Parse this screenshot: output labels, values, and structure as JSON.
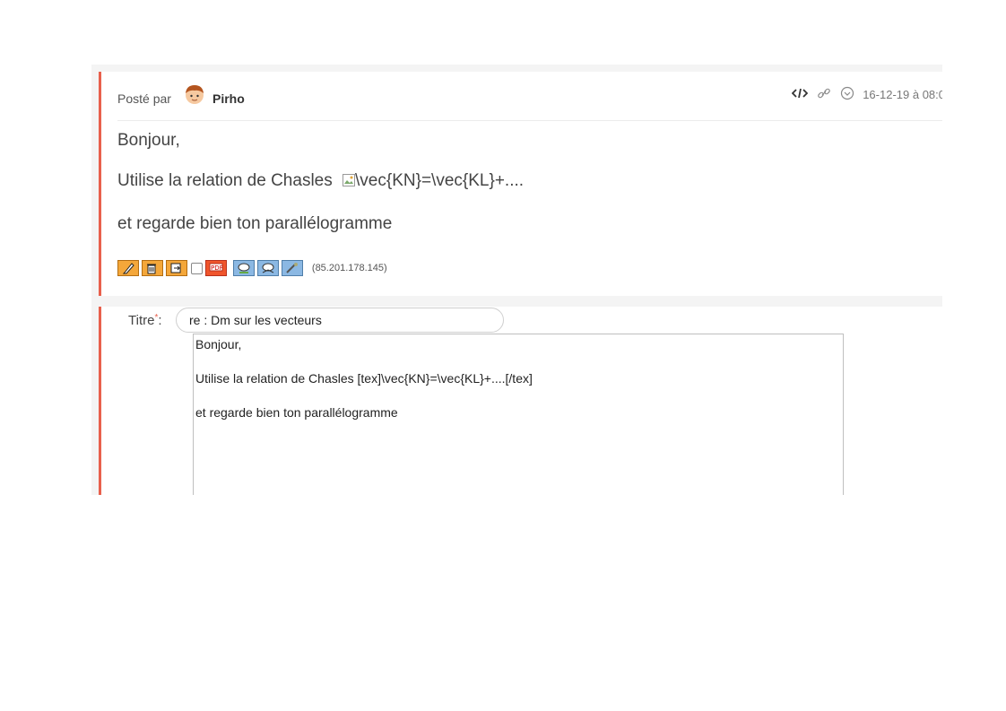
{
  "post": {
    "posted_by_label": "Posté par",
    "author": "Pirho",
    "date": "16-12-19 à 08:0",
    "body": {
      "greeting": "Bonjour,",
      "line1_prefix": "Utilise la relation de Chasles",
      "line1_img_alt": "\\vec{KN}=\\vec{KL}+....",
      "line2": "et regarde bien ton parallélogramme"
    },
    "ip": "(85.201.178.145)",
    "icons": {
      "code": "code-icon",
      "link": "link-icon",
      "clock": "clock-icon",
      "edit": "pencil-icon",
      "delete": "trash-icon",
      "move": "move-icon",
      "pdf": "pdf-icon",
      "tools": "tools-icon"
    }
  },
  "reply": {
    "title_label": "Titre",
    "required_mark": "*",
    "title_sep": ":",
    "title_value": "re : Dm sur les vecteurs",
    "editor": {
      "line1": "Bonjour,",
      "line2": "Utilise la relation de Chasles  [tex]\\vec{KN}=\\vec{KL}+....[/tex]",
      "line3": "et regarde bien ton parallélogramme"
    }
  },
  "colors": {
    "accent": "#e8604c",
    "button_orange": "#f4a73a"
  }
}
